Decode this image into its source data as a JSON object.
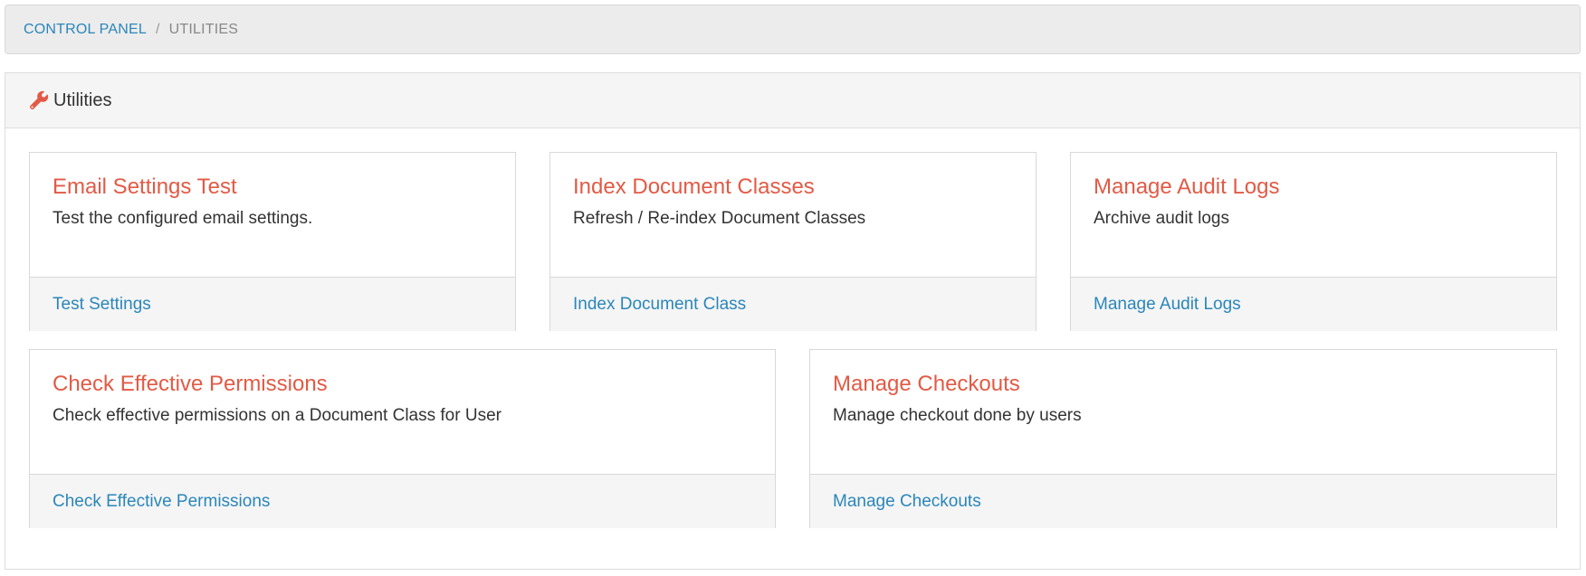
{
  "breadcrumb": {
    "home": "CONTROL PANEL",
    "separator": "/",
    "current": "UTILITIES"
  },
  "panel": {
    "title": "Utilities",
    "icon": "wrench-icon"
  },
  "colors": {
    "accent_title": "#e25a45",
    "link": "#2a86ba",
    "icon": "#e25a45"
  },
  "cards": [
    {
      "title": "Email Settings Test",
      "description": "Test the configured email settings.",
      "link": "Test Settings"
    },
    {
      "title": "Index Document Classes",
      "description": "Refresh / Re-index Document Classes",
      "link": "Index Document Class"
    },
    {
      "title": "Manage Audit Logs",
      "description": "Archive audit logs",
      "link": "Manage Audit Logs"
    },
    {
      "title": "Check Effective Permissions",
      "description": "Check effective permissions on a Document Class for User",
      "link": "Check Effective Permissions"
    },
    {
      "title": "Manage Checkouts",
      "description": "Manage checkout done by users",
      "link": "Manage Checkouts"
    }
  ]
}
